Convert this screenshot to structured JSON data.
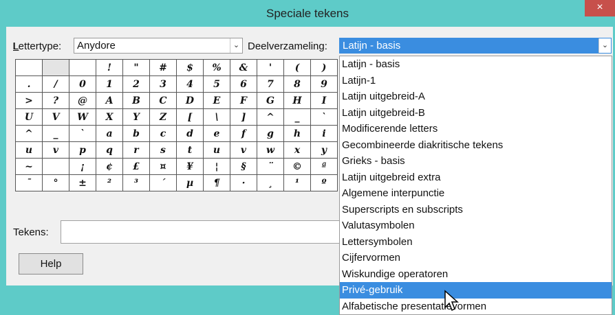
{
  "window": {
    "title": "Speciale tekens",
    "close_glyph": "×"
  },
  "font": {
    "label": "Lettertype:",
    "value": "Anydore"
  },
  "subset": {
    "label": "Deelverzameling:",
    "value": "Latijn - basis"
  },
  "grid": [
    [
      "",
      "",
      "",
      "!",
      "\"",
      "#",
      "$",
      "%",
      "&",
      "'",
      "(",
      ")"
    ],
    [
      ".",
      "/",
      "0",
      "1",
      "2",
      "3",
      "4",
      "5",
      "6",
      "7",
      "8",
      "9"
    ],
    [
      ">",
      "?",
      "@",
      "A",
      "B",
      "C",
      "D",
      "E",
      "F",
      "G",
      "H",
      "I"
    ],
    [
      "U",
      "V",
      "W",
      "X",
      "Y",
      "Z",
      "[",
      "\\",
      "]",
      "^",
      "_",
      "`"
    ],
    [
      "^",
      "_",
      "`",
      "a",
      "b",
      "c",
      "d",
      "e",
      "f",
      "g",
      "h",
      "i"
    ],
    [
      "u",
      "v",
      "p",
      "q",
      "r",
      "s",
      "t",
      "u",
      "v",
      "w",
      "x",
      "y"
    ],
    [
      "~",
      "",
      "¡",
      "¢",
      "£",
      "¤",
      "¥",
      "¦",
      "§",
      "¨",
      "©",
      "ª"
    ],
    [
      "¯",
      "°",
      "±",
      "²",
      "³",
      "´",
      "µ",
      "¶",
      "·",
      "¸",
      "¹",
      "º"
    ]
  ],
  "tekens": {
    "label": "Tekens:",
    "value": ""
  },
  "help_label": "Help",
  "dropdown_options": [
    "Latijn - basis",
    "Latijn-1",
    "Latijn uitgebreid-A",
    "Latijn uitgebreid-B",
    "Modificerende letters",
    "Gecombineerde diakritische tekens",
    "Grieks - basis",
    "Latijn uitgebreid extra",
    "Algemene interpunctie",
    "Superscripts en subscripts",
    "Valutasymbolen",
    "Lettersymbolen",
    "Cijfervormen",
    "Wiskundige operatoren",
    "Privé-gebruik",
    "Alfabetische presentatievormen"
  ],
  "highlighted_option": "Privé-gebruik"
}
